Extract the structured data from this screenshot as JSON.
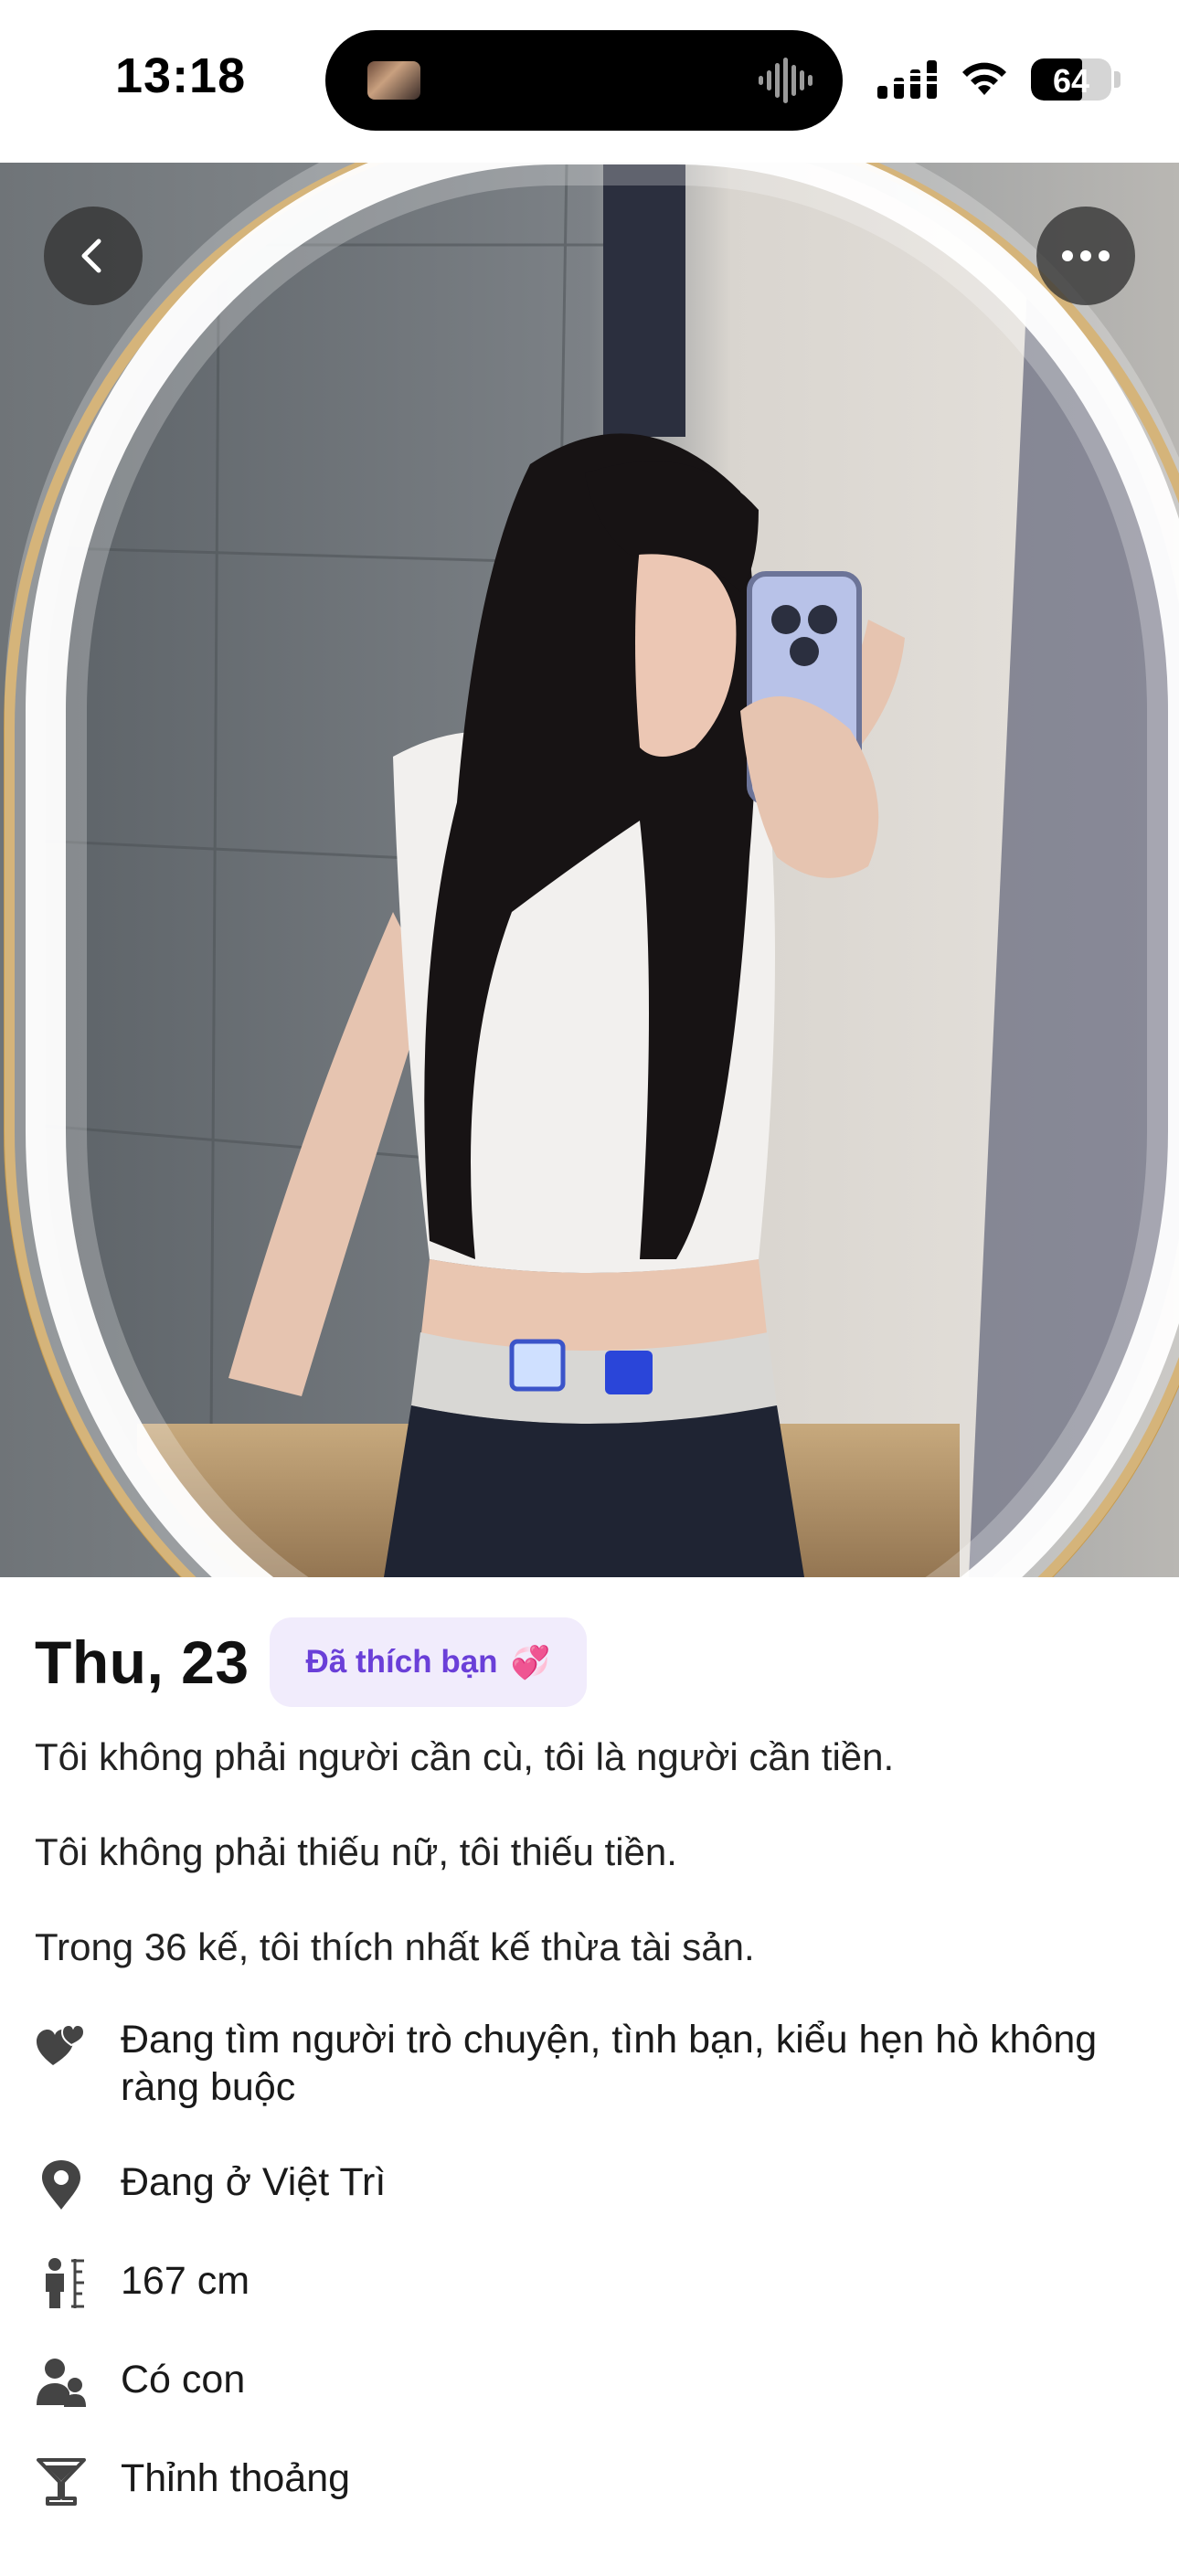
{
  "status_bar": {
    "time": "13:18",
    "battery_level": "64",
    "icons": [
      "media-thumbnail-icon",
      "audio-wave-icon",
      "cellular-signal-icon",
      "wifi-icon",
      "battery-icon"
    ]
  },
  "photo": {
    "description_icons": [
      "back-icon",
      "more-icon"
    ],
    "back_icon": "chevron-left-icon",
    "more_icon": "ellipsis-icon"
  },
  "profile": {
    "name_age": "Thu, 23",
    "liked_badge": "Đã thích bạn",
    "liked_badge_emoji": "💞",
    "accent_color": "#6a3fd8",
    "badge_bg": "#f1ecfc",
    "bio": [
      "Tôi không phải người cần cù, tôi là người cần tiền.",
      "Tôi không phải thiếu nữ, tôi thiếu tiền.",
      "Trong 36 kế, tôi thích nhất kế thừa tài sản."
    ],
    "details": [
      {
        "icon": "hearts-icon",
        "text": "Đang tìm người trò chuyện, tình bạn, kiểu hẹn hò không ràng buộc"
      },
      {
        "icon": "location-pin-icon",
        "text": "Đang ở Việt Trì"
      },
      {
        "icon": "height-icon",
        "text": "167 cm"
      },
      {
        "icon": "children-icon",
        "text": "Có con"
      },
      {
        "icon": "cocktail-glass-icon",
        "text": "Thỉnh thoảng"
      }
    ]
  }
}
